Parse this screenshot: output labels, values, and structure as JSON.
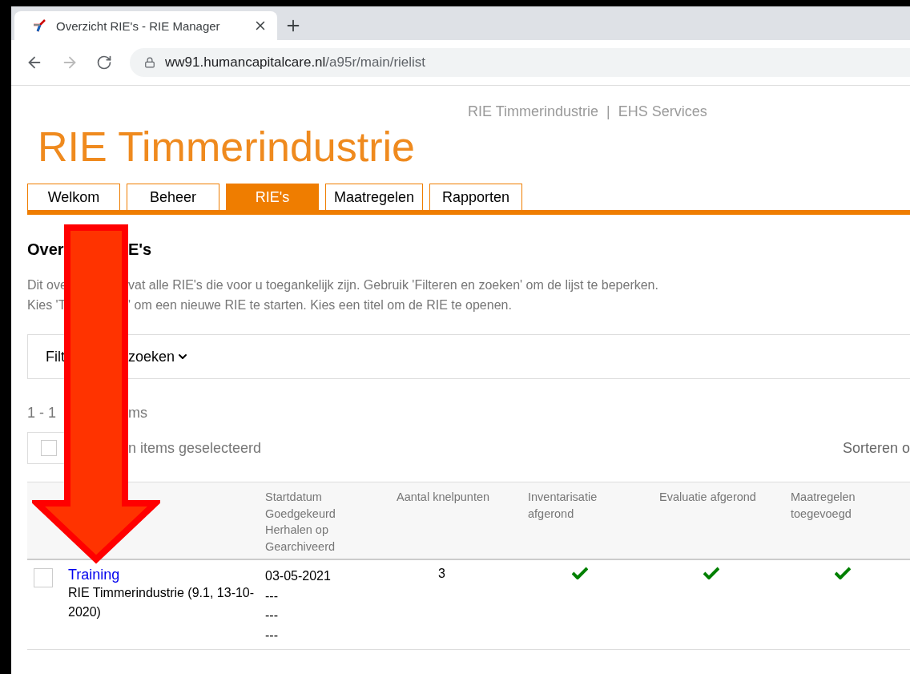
{
  "browser": {
    "tab_title": "Overzicht RIE's - RIE Manager",
    "url_host": "ww91.humancapitalcare.nl",
    "url_path": "/a95r/main/rielist"
  },
  "header": {
    "subtitle": "RIE Timmerindustrie  |  EHS Services",
    "title": "RIE Timmerindustrie"
  },
  "tabs": [
    {
      "label": "Welkom",
      "selected": false
    },
    {
      "label": "Beheer",
      "selected": false
    },
    {
      "label": "RIE's",
      "selected": true
    },
    {
      "label": "Maatregelen",
      "selected": false
    },
    {
      "label": "Rapporten",
      "selected": false
    }
  ],
  "heading": [
    "Over",
    "E's"
  ],
  "intro": [
    [
      "Dit ove",
      "vat alle RIE's die voor u toegankelijk zijn. Gebruik 'Filteren en zoeken' om de lijst te beperken."
    ],
    [
      "Kies 'T",
      "' om een nieuwe RIE te starten. Kies een titel om de RIE te openen."
    ]
  ],
  "filter": [
    "Filt",
    "zoeken"
  ],
  "count": [
    "1 - 1",
    "ms"
  ],
  "selection": {
    "checked": false,
    "text": "n items geselecteerd"
  },
  "sort_label": "Sorteren o",
  "table": {
    "columns": [
      "Startdatum\nGoedgekeurd\nHerhalen op\nGearchiveerd",
      "Aantal knelpunten",
      "Inventarisatie afgerond",
      "Evaluatie afgerond",
      "Maatregelen toegevoegd"
    ],
    "rows": [
      {
        "checked": false,
        "title": "Training",
        "subtitle": "RIE Timmerindustrie (9.1, 13-10-2020)",
        "dates": [
          "03-05-2021",
          "---",
          "---",
          "---"
        ],
        "count": "3",
        "checks": [
          true,
          true,
          true
        ]
      }
    ]
  }
}
